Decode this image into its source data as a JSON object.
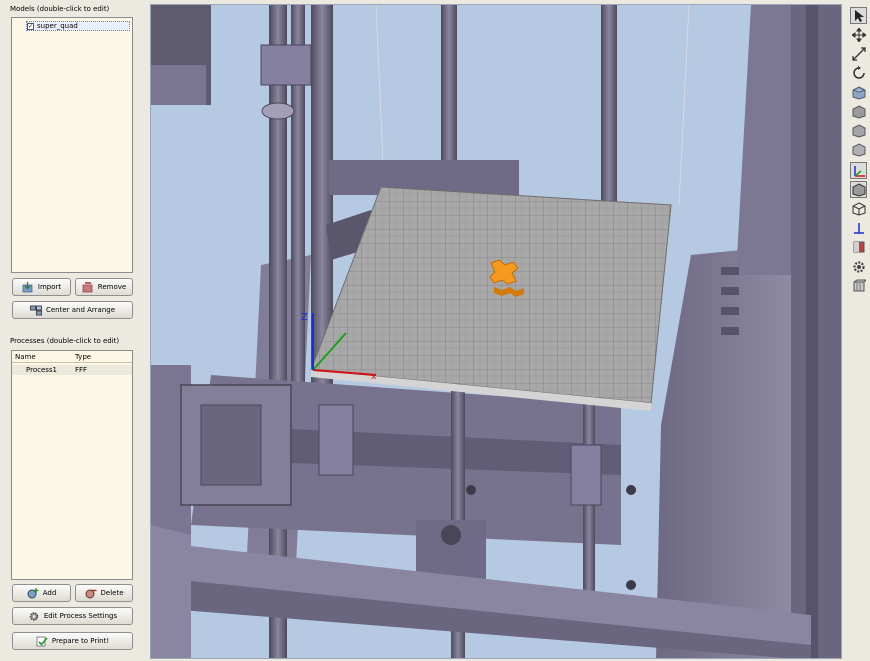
{
  "models": {
    "title": "Models (double-click to edit)",
    "items": [
      {
        "label": "super_quad",
        "checked": true
      }
    ],
    "import_label": "Import",
    "remove_label": "Remove",
    "center_label": "Center and Arrange"
  },
  "processes": {
    "title": "Processes (double-click to edit)",
    "columns": [
      "Name",
      "Type"
    ],
    "rows": [
      {
        "name": "Process1",
        "type": "FFF"
      }
    ],
    "add_label": "Add",
    "delete_label": "Delete",
    "edit_label": "Edit Process Settings",
    "prepare_label": "Prepare to Print!"
  },
  "viewport": {
    "background": "#b6c9e2",
    "frame_color": "#6a6578",
    "bed_color": "#a6a6a6",
    "model_color": "#f59a1e"
  },
  "toolbar": {
    "tools": [
      "select-icon",
      "move-icon",
      "rotate-icon",
      "view-top-icon",
      "view-front-icon",
      "view-left-icon",
      "view-right-icon",
      "axes-toggle-icon",
      "solid-view-icon",
      "wireframe-view-icon",
      "z-axis-icon",
      "cut-icon",
      "settings-gear-icon",
      "build-volume-icon"
    ]
  }
}
